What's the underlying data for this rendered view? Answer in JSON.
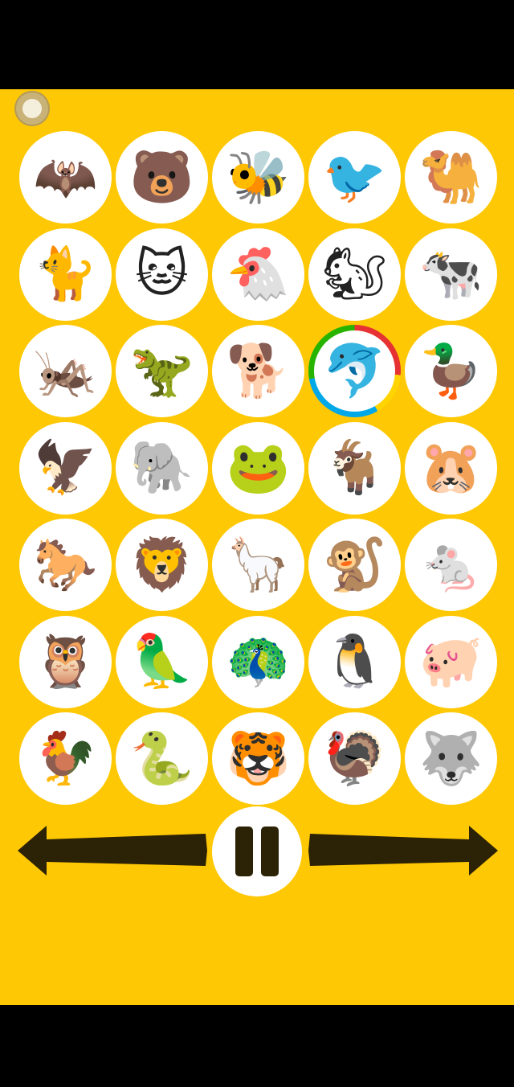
{
  "colors": {
    "background": "#ffc804",
    "circle": "#ffffff",
    "control_dark": "#2c2206"
  },
  "settings": {
    "icon": "settings-dot-icon"
  },
  "animals": [
    {
      "name": "bat",
      "glyph": "🦇"
    },
    {
      "name": "bear",
      "glyph": "🐻"
    },
    {
      "name": "bee",
      "glyph": "🐝"
    },
    {
      "name": "cardinal",
      "glyph": "🐦"
    },
    {
      "name": "camel",
      "glyph": "🐫"
    },
    {
      "name": "black-cat",
      "glyph": "🐈"
    },
    {
      "name": "cat",
      "glyph": "🐱"
    },
    {
      "name": "chicken",
      "glyph": "🐔"
    },
    {
      "name": "chipmunk",
      "glyph": "🐿"
    },
    {
      "name": "cow",
      "glyph": "🐄"
    },
    {
      "name": "cricket",
      "glyph": "🦗"
    },
    {
      "name": "dinosaur",
      "glyph": "🦖"
    },
    {
      "name": "dog",
      "glyph": "🐕"
    },
    {
      "name": "dolphin",
      "glyph": "🐬",
      "selected": true
    },
    {
      "name": "duck",
      "glyph": "🦆"
    },
    {
      "name": "eagle",
      "glyph": "🦅"
    },
    {
      "name": "elephant",
      "glyph": "🐘"
    },
    {
      "name": "frog",
      "glyph": "🐸"
    },
    {
      "name": "goat",
      "glyph": "🐐"
    },
    {
      "name": "hamster",
      "glyph": "🐹"
    },
    {
      "name": "horse",
      "glyph": "🐎"
    },
    {
      "name": "lion",
      "glyph": "🦁"
    },
    {
      "name": "llama",
      "glyph": "🦙"
    },
    {
      "name": "monkey",
      "glyph": "🐒"
    },
    {
      "name": "mouse",
      "glyph": "🐁"
    },
    {
      "name": "owl",
      "glyph": "🦉"
    },
    {
      "name": "parrot",
      "glyph": "🦜"
    },
    {
      "name": "peacock",
      "glyph": "🦚"
    },
    {
      "name": "penguin",
      "glyph": "🐧"
    },
    {
      "name": "pig",
      "glyph": "🐖"
    },
    {
      "name": "rooster",
      "glyph": "🐓"
    },
    {
      "name": "snake",
      "glyph": "🐍"
    },
    {
      "name": "tiger",
      "glyph": "🐯"
    },
    {
      "name": "turkey",
      "glyph": "🦃"
    },
    {
      "name": "wolf",
      "glyph": "🐺"
    }
  ],
  "controls": {
    "previous_icon": "arrow-left-icon",
    "pause_icon": "pause-icon",
    "next_icon": "arrow-right-icon"
  }
}
